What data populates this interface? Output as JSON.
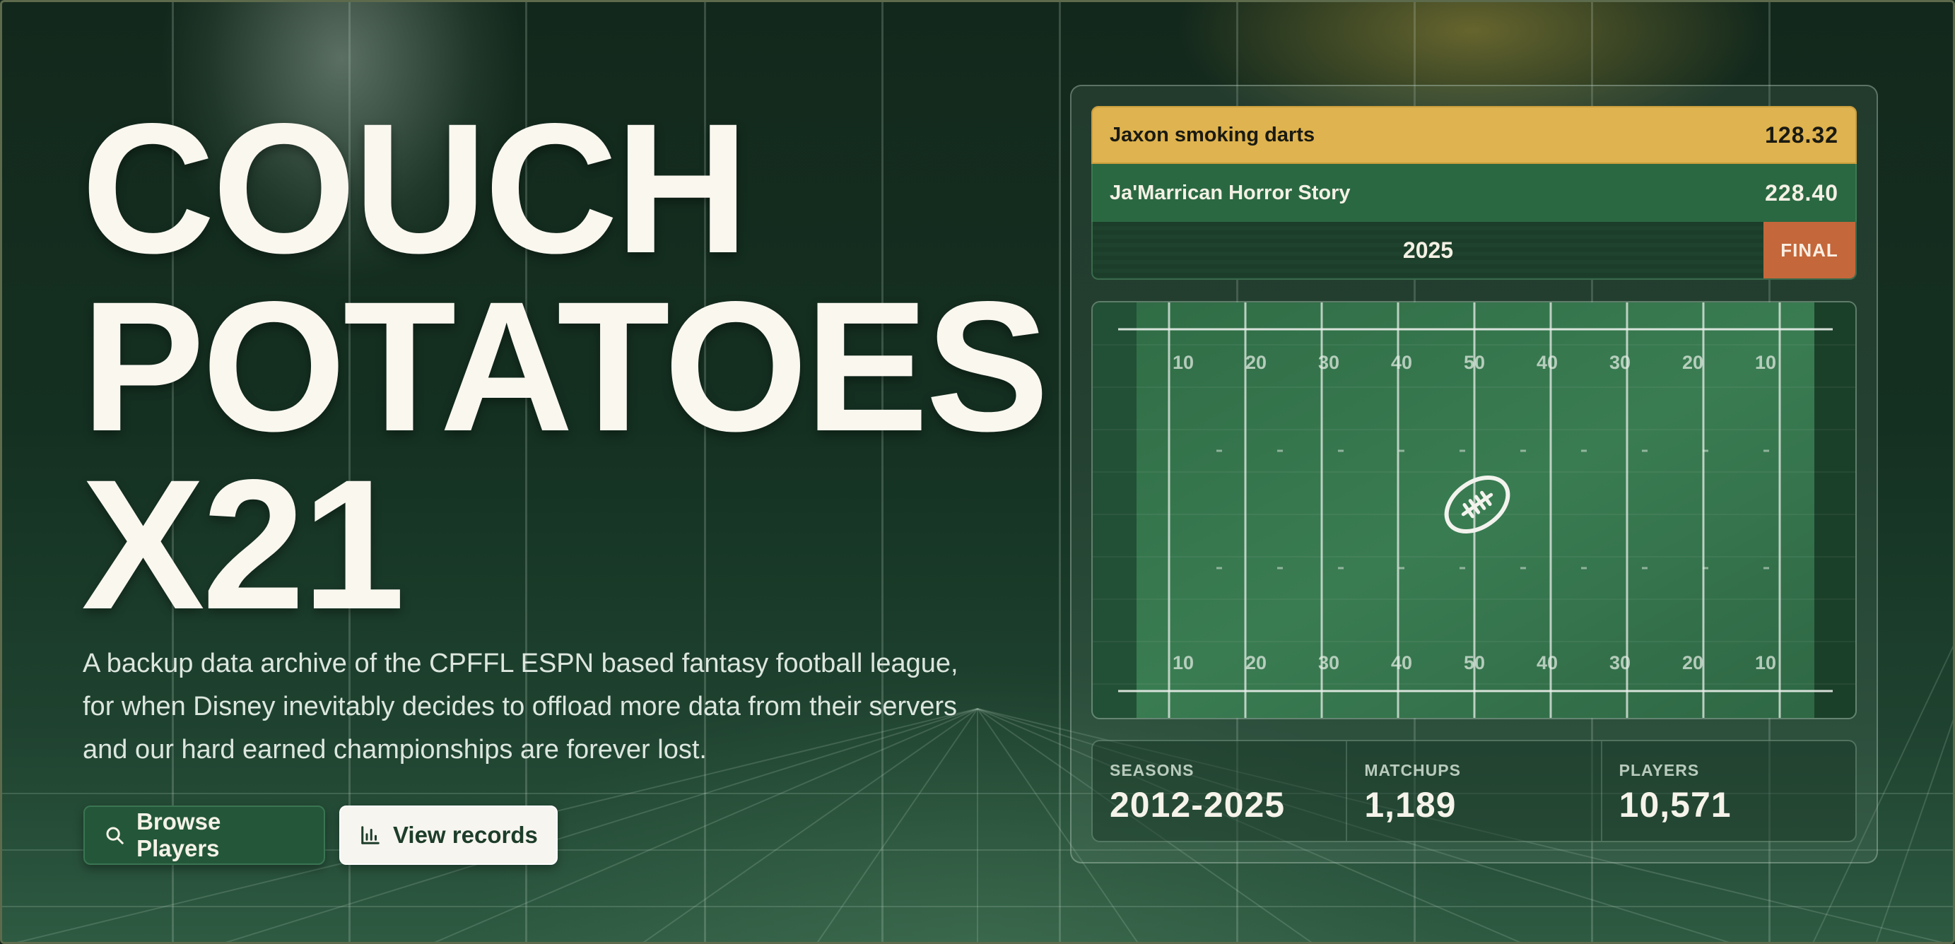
{
  "hero": {
    "title_lines": [
      "COUCH",
      "POTATOES",
      "X21"
    ],
    "description_lines": [
      "A backup data archive of the CPFFL ESPN based fantasy football league,",
      "for when Disney inevitably decides to offload more data from their servers",
      "and our hard earned championships are forever lost."
    ],
    "buttons": {
      "browse": {
        "label": "Browse Players",
        "icon": "search-icon"
      },
      "records": {
        "label": "View records",
        "icon": "bar-chart-icon"
      }
    }
  },
  "scoreboard": {
    "team1": {
      "name": "Jaxon smoking darts",
      "score": "128.32"
    },
    "team2": {
      "name": "Ja'Marrican Horror Story",
      "score": "228.40"
    },
    "year": "2025",
    "status": "FINAL",
    "colors": {
      "team1_bg": "#dfb34f",
      "team2_bg": "#2a6842",
      "final_bg": "#c4673a"
    }
  },
  "field": {
    "yard_numbers": [
      "10",
      "20",
      "30",
      "40",
      "50",
      "40",
      "30",
      "20",
      "10"
    ],
    "center_icon": "football-icon"
  },
  "stats": [
    {
      "label": "SEASONS",
      "value": "2012-2025"
    },
    {
      "label": "MATCHUPS",
      "value": "1,189"
    },
    {
      "label": "PLAYERS",
      "value": "10,571"
    }
  ]
}
